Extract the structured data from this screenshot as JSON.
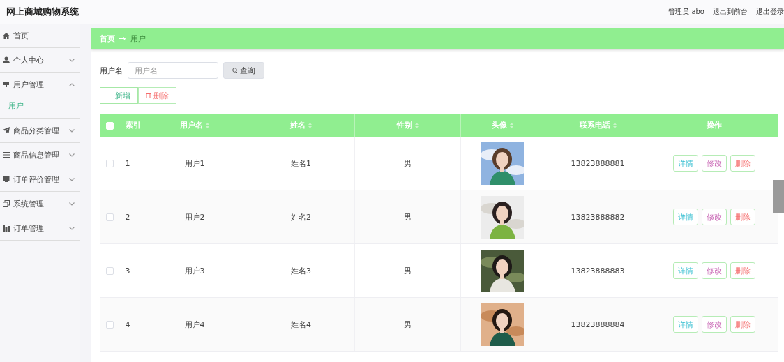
{
  "header": {
    "title": "网上商城购物系统",
    "user": "管理员 abo",
    "links": [
      "退出到前台",
      "退出登录"
    ]
  },
  "sidebar": {
    "items": [
      {
        "label": "首页"
      },
      {
        "label": "个人中心",
        "expanded": false
      },
      {
        "label": "用户管理",
        "expanded": true,
        "children": [
          {
            "label": "用户",
            "selected": true
          }
        ]
      },
      {
        "label": "商品分类管理",
        "expanded": false
      },
      {
        "label": "商品信息管理",
        "expanded": false
      },
      {
        "label": "订单评价管理",
        "expanded": false
      },
      {
        "label": "系统管理",
        "expanded": false
      },
      {
        "label": "订单管理",
        "expanded": false
      }
    ]
  },
  "breadcrumb": [
    "首页",
    "用户"
  ],
  "search": {
    "label": "用户名",
    "placeholder": "用户名",
    "button": "查询"
  },
  "actions": [
    {
      "label": "新增",
      "kind": "add"
    },
    {
      "label": "删除",
      "kind": "delete"
    }
  ],
  "table": {
    "all_checked": false,
    "columns": [
      {
        "label": "索引",
        "sortable": false
      },
      {
        "label": "用户名",
        "sortable": true
      },
      {
        "label": "姓名",
        "sortable": true
      },
      {
        "label": "性别",
        "sortable": true
      },
      {
        "label": "头像",
        "sortable": true
      },
      {
        "label": "联系电话",
        "sortable": true
      },
      {
        "label": "操作",
        "sortable": false
      }
    ],
    "rows": [
      {
        "checked": false,
        "index": "1",
        "username": "用户1",
        "name": "姓名1",
        "gender": "男",
        "avatar": {
          "kind": "picture"
        },
        "phone": "13823888881",
        "buttons": [
          "详情",
          "修改",
          "删除"
        ]
      },
      {
        "checked": false,
        "index": "2",
        "username": "用户2",
        "name": "姓名2",
        "gender": "男",
        "avatar": {
          "kind": "picture"
        },
        "phone": "13823888882",
        "buttons": [
          "详情",
          "修改",
          "删除"
        ]
      },
      {
        "checked": false,
        "index": "3",
        "username": "用户3",
        "name": "姓名3",
        "gender": "男",
        "avatar": {
          "kind": "picture"
        },
        "phone": "13823888883",
        "buttons": [
          "详情",
          "修改",
          "删除"
        ]
      },
      {
        "checked": false,
        "index": "4",
        "username": "用户4",
        "name": "姓名4",
        "gender": "男",
        "avatar": {
          "kind": "picture"
        },
        "phone": "13823888884",
        "buttons": [
          "详情",
          "修改",
          "删除"
        ]
      }
    ]
  }
}
